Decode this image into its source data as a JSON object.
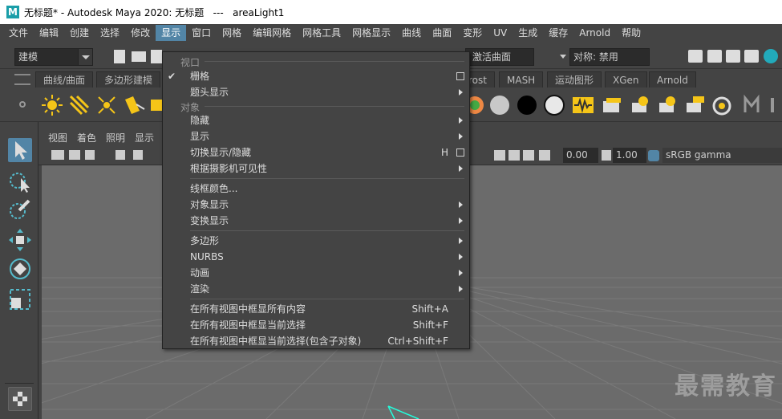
{
  "titlebar": {
    "title": "无标题* - Autodesk Maya 2020: 无标题   ---   areaLight1",
    "logo": "M"
  },
  "menubar": [
    "文件",
    "编辑",
    "创建",
    "选择",
    "修改",
    "显示",
    "窗口",
    "网格",
    "编辑网格",
    "网格工具",
    "网格显示",
    "曲线",
    "曲面",
    "变形",
    "UV",
    "生成",
    "缓存",
    "Arnold",
    "帮助"
  ],
  "statusline": {
    "mode": "建模",
    "live": "激活曲面",
    "symmetry": "对称: 禁用"
  },
  "shelf_tabs": [
    "曲线/曲面",
    "多边形建模",
    "rost",
    "MASH",
    "运动图形",
    "XGen",
    "Arnold"
  ],
  "panel_menu": [
    "视图",
    "着色",
    "照明",
    "显示"
  ],
  "panel_toolbar": {
    "val1": "0.00",
    "val2": "1.00",
    "colorspace": "sRGB gamma"
  },
  "menu": {
    "section_view": "视口",
    "section_object": "对象",
    "items": {
      "grid": "栅格",
      "headsup": "题头显示",
      "hide": "隐藏",
      "show": "显示",
      "toggle": "切换显示/隐藏",
      "toggle_sc": "H",
      "camera": "根据摄影机可见性",
      "wire": "线框颜色...",
      "objdisp": "对象显示",
      "transdisp": "变换显示",
      "poly": "多边形",
      "nurbs": "NURBS",
      "anim": "动画",
      "render": "渲染",
      "frameall": "在所有视图中框显所有内容",
      "frameall_sc": "Shift+A",
      "framesel": "在所有视图中框显当前选择",
      "framesel_sc": "Shift+F",
      "framesubs": "在所有视图中框显当前选择(包含子对象)",
      "framesubs_sc": "Ctrl+Shift+F"
    }
  },
  "watermark": "最需教育",
  "colors": {
    "accent": "#5285a6",
    "menu_bg": "#444444",
    "viewport": "#6b6b6b"
  }
}
